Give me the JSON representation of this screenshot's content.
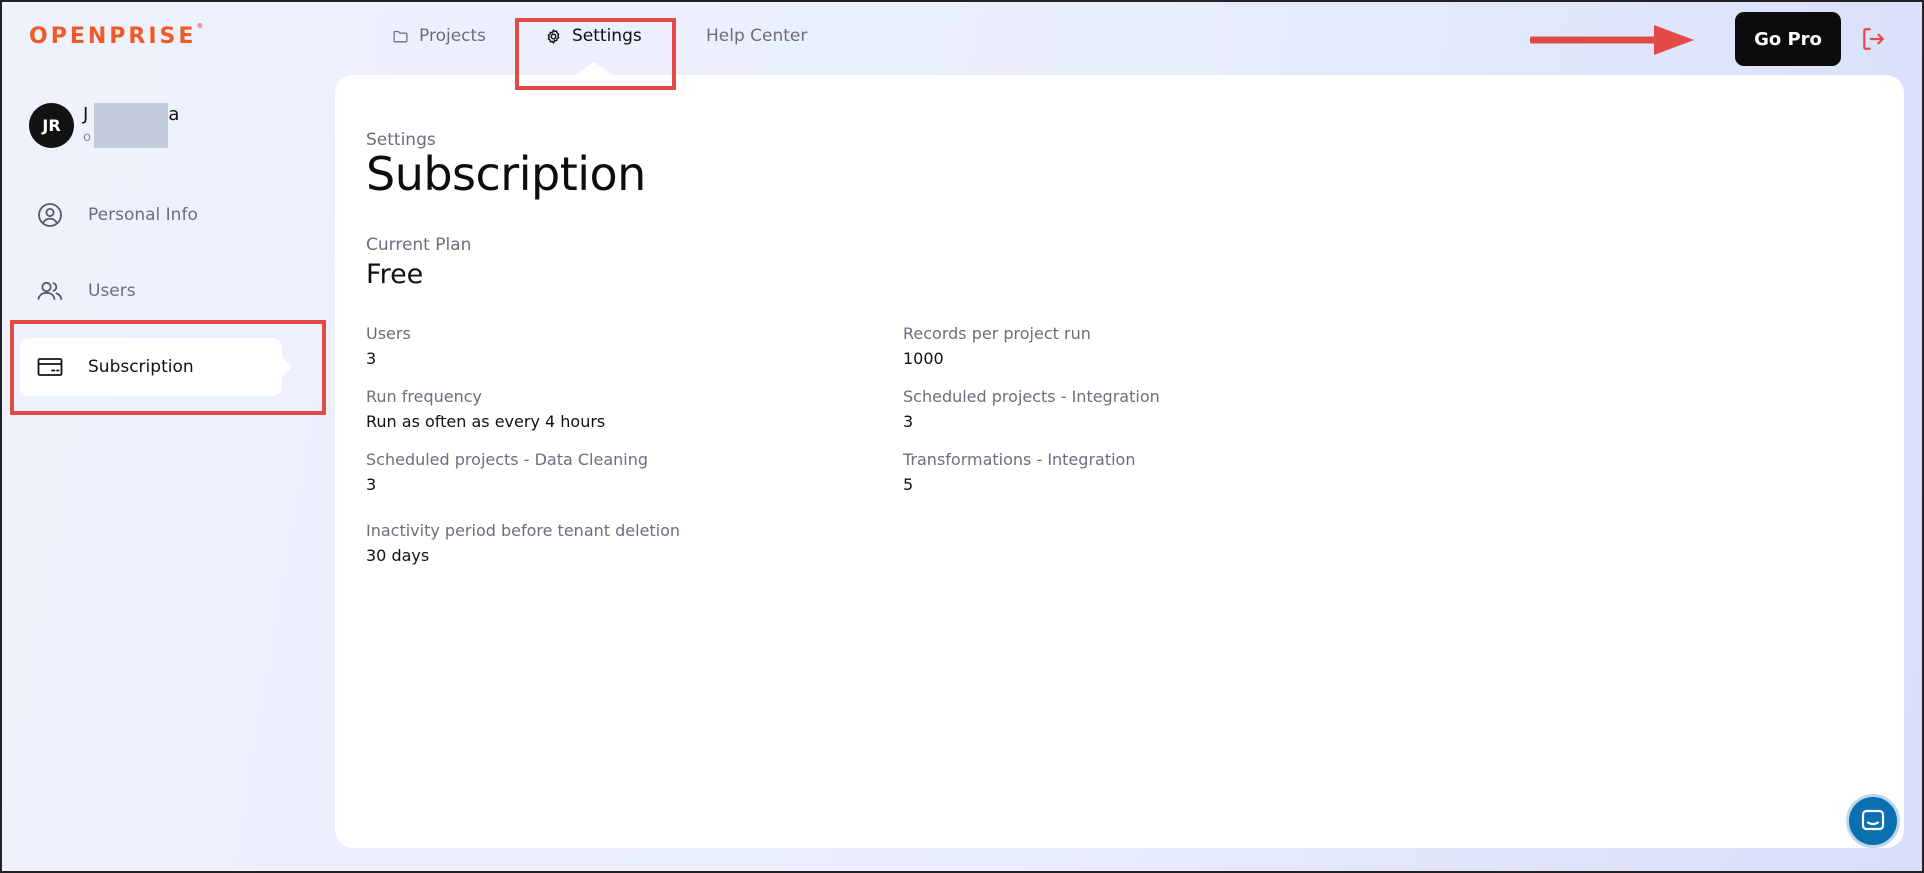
{
  "header": {
    "logo": "OPENPRISE",
    "logo_mark": "®",
    "nav": [
      {
        "label": "Projects",
        "icon": "folder-icon"
      },
      {
        "label": "Settings",
        "icon": "gear-icon"
      },
      {
        "label": "Help Center"
      }
    ],
    "go_pro_label": "Go Pro",
    "logout_icon": "logout-icon"
  },
  "user": {
    "initials": "JR",
    "name_start": "J",
    "name_end": "a",
    "sub_start": "o"
  },
  "sidebar": {
    "items": [
      {
        "label": "Personal Info",
        "icon": "user-circle-icon"
      },
      {
        "label": "Users",
        "icon": "users-icon"
      },
      {
        "label": "Subscription",
        "icon": "credit-card-icon"
      }
    ]
  },
  "main": {
    "breadcrumb": "Settings",
    "title": "Subscription",
    "current_plan_label": "Current Plan",
    "current_plan_value": "Free",
    "fields": [
      {
        "label": "Users",
        "value": "3"
      },
      {
        "label": "Records per project run",
        "value": "1000"
      },
      {
        "label": "Run frequency",
        "value": "Run as often as every 4 hours"
      },
      {
        "label": "Scheduled projects - Integration",
        "value": "3"
      },
      {
        "label": "Scheduled projects - Data Cleaning",
        "value": "3"
      },
      {
        "label": "Transformations - Integration",
        "value": "5"
      },
      {
        "label": "Inactivity period before tenant deletion",
        "value": "30 days"
      }
    ]
  },
  "colors": {
    "brand": "#f05a28",
    "annotation": "#e24a45",
    "chat": "#0b6fb0"
  }
}
